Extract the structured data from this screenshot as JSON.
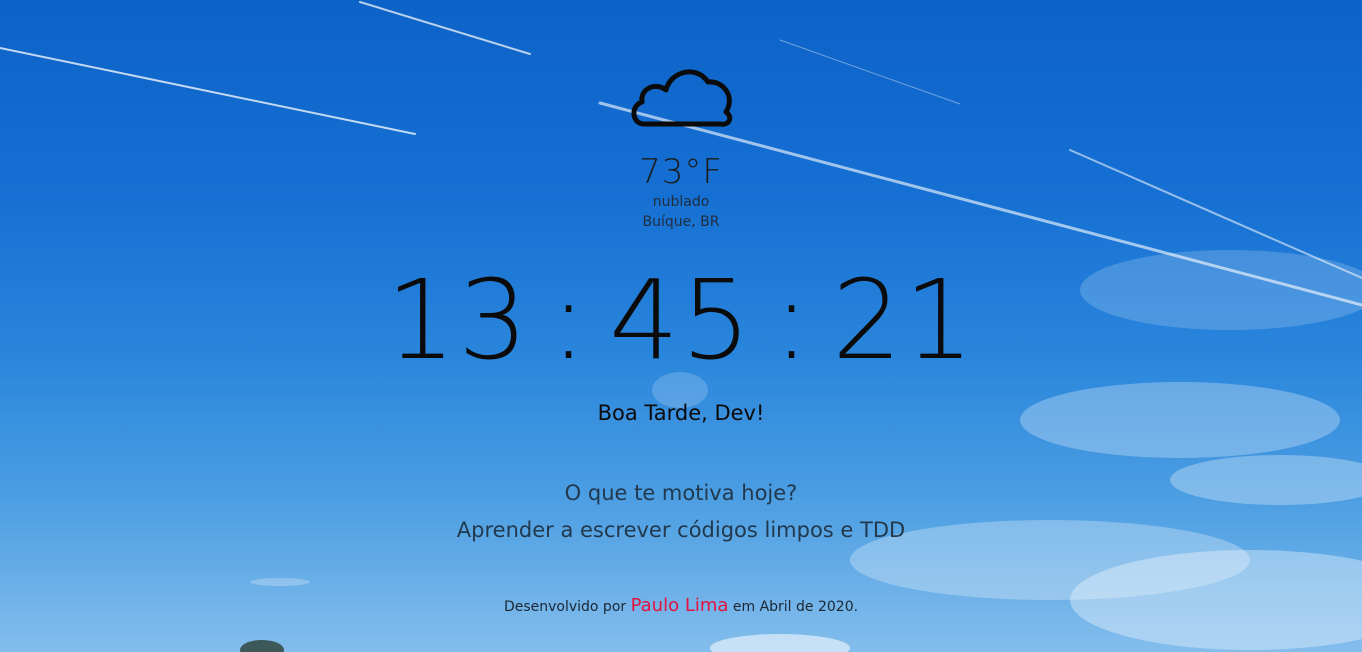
{
  "weather": {
    "icon": "cloud-icon",
    "temperature": "73°F",
    "description": "nublado",
    "location": "Buíque, BR"
  },
  "clock": {
    "hours": "13",
    "minutes": "45",
    "seconds": "21",
    "separator": ":"
  },
  "greeting": "Boa Tarde, Dev!",
  "focus": {
    "question": "O que te motiva hoje?",
    "answer": "Aprender a escrever códigos limpos e TDD"
  },
  "credits": {
    "prefix": "Desenvolvido por",
    "author": "Paulo Lima",
    "suffix": "em Abril de 2020."
  },
  "colors": {
    "sky_top": "#0d62c7",
    "sky_bottom": "#83bdec",
    "author_link": "#e3123f"
  }
}
